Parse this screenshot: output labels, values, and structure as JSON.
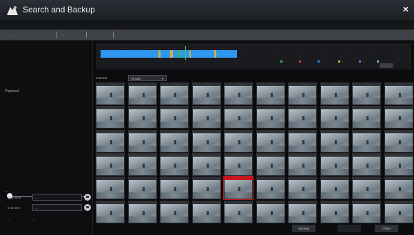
{
  "window": {
    "title": "Search and Backup",
    "close_glyph": "×"
  },
  "tabs": [
    "…",
    "…",
    "…",
    "…",
    "…",
    "…"
  ],
  "subtabs": [
    "…",
    "…",
    "…",
    "…"
  ],
  "left": {
    "playback_label": "Playback",
    "backup_info_label": "…",
    "start_time_label": "Start time",
    "start_time_value": "…",
    "end_time_label": "End time",
    "end_time_value": "…",
    "duration_label": "…",
    "duration_value": "…",
    "data_size_label": "…"
  },
  "timeline": {
    "top_label": "…",
    "ticks": [
      "…",
      "…",
      "…",
      "…",
      "…",
      "…",
      "…",
      "…",
      "…",
      "…",
      "…",
      "…",
      "…"
    ],
    "legend": [
      {
        "label": "…",
        "color": "#3fbf4a"
      },
      {
        "label": "…",
        "color": "#e0402f"
      },
      {
        "label": "…",
        "color": "#2f97f0"
      },
      {
        "label": "…",
        "color": "#c9b63b"
      },
      {
        "label": "…",
        "color": "#9a57d6"
      },
      {
        "label": "…",
        "color": "#6fb2ff"
      }
    ],
    "cancel_button": "…"
  },
  "controls": {
    "camera_label": "Camera",
    "camera_value": "All cam",
    "total_label": "…"
  },
  "thumbs": {
    "header_text": "…",
    "selected_index": 44,
    "count": 60
  },
  "buttons": {
    "backup": "Backup",
    "middle": "…",
    "close": "Close"
  },
  "colors": {
    "accent": "#c7161d",
    "timeline": "#2f97f0",
    "active_tab": "#ff3b3b"
  }
}
